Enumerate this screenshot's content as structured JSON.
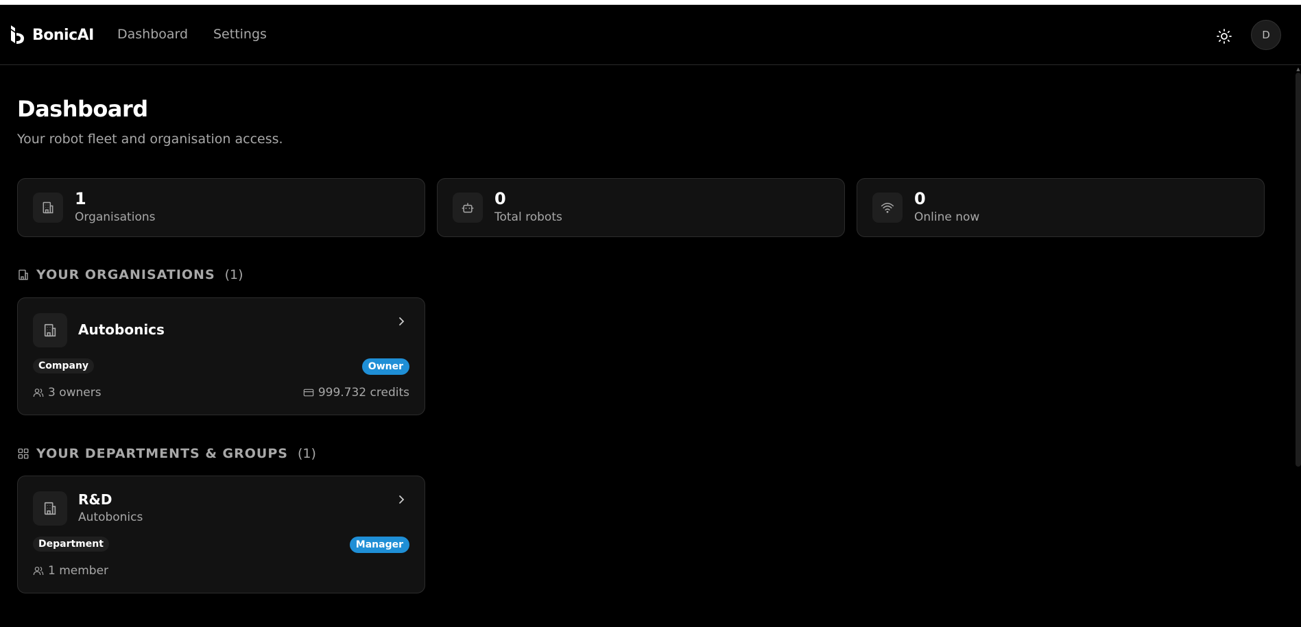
{
  "header": {
    "brand": "BonicAI",
    "nav": [
      {
        "label": "Dashboard"
      },
      {
        "label": "Settings"
      }
    ],
    "avatar_initial": "D"
  },
  "page": {
    "title": "Dashboard",
    "subtitle": "Your robot fleet and organisation access."
  },
  "stats": [
    {
      "value": "1",
      "label": "Organisations",
      "icon": "building-icon"
    },
    {
      "value": "0",
      "label": "Total robots",
      "icon": "robot-icon"
    },
    {
      "value": "0",
      "label": "Online now",
      "icon": "wifi-icon"
    }
  ],
  "organisations": {
    "title": "YOUR ORGANISATIONS",
    "count": "(1)",
    "items": [
      {
        "name": "Autobonics",
        "type": "Company",
        "role": "Owner",
        "members": "3 owners",
        "credits": "999.732 credits"
      }
    ]
  },
  "departments": {
    "title": "YOUR DEPARTMENTS & GROUPS",
    "count": "(1)",
    "items": [
      {
        "name": "R&D",
        "parent": "Autobonics",
        "type": "Department",
        "role": "Manager",
        "members": "1 member"
      }
    ]
  },
  "colors": {
    "background": "#000000",
    "card": "#121212",
    "border": "#2c2c2c",
    "accent": "#1f8fd6",
    "muted_text": "#a8a8a8"
  }
}
